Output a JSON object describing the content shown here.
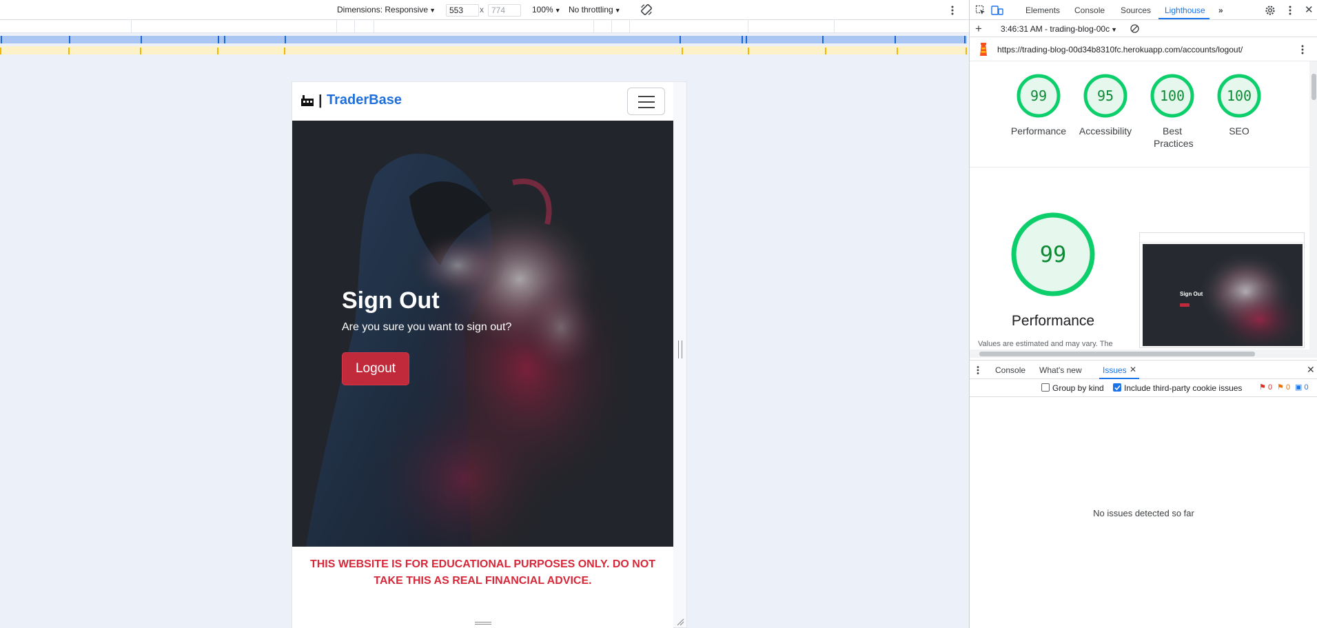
{
  "device_toolbar": {
    "dimensions_label": "Dimensions: Responsive",
    "width_value": "553",
    "times": "x",
    "height_value": "774",
    "zoom": "100%",
    "throttling": "No throttling"
  },
  "page": {
    "brand_separator": "|",
    "brand_name": "TraderBase",
    "hero_title": "Sign Out",
    "hero_subtitle": "Are you sure you want to sign out?",
    "logout_label": "Logout",
    "disclaimer": "THIS WEBSITE IS FOR EDUCATIONAL PURPOSES ONLY. DO NOT TAKE THIS AS REAL FINANCIAL ADVICE."
  },
  "devtools": {
    "tabs": [
      "Elements",
      "Console",
      "Sources",
      "Lighthouse"
    ],
    "active_tab": "Lighthouse",
    "report_selector": "3:46:31 AM - trading-blog-00c",
    "url": "https://trading-blog-00d34b8310fc.herokuapp.com/accounts/logout/",
    "scores": [
      {
        "value": "99",
        "label": "Performance"
      },
      {
        "value": "95",
        "label": "Accessibility"
      },
      {
        "value": "100",
        "label": "Best Practices"
      },
      {
        "value": "100",
        "label": "SEO"
      }
    ],
    "main_score": {
      "value": "99",
      "label": "Performance"
    },
    "estimate_note": "Values are estimated and may vary. The",
    "thumb_title": "Sign Out",
    "drawer_tabs": [
      "Console",
      "What's new",
      "Issues"
    ],
    "active_drawer_tab": "Issues",
    "group_by_kind": "Group by kind",
    "include_third_party": "Include third-party cookie issues",
    "counts": {
      "errors": "0",
      "warnings": "0",
      "info": "0"
    },
    "no_issues": "No issues detected so far"
  },
  "colors": {
    "brand": "#1e6fdc",
    "danger": "#c02a3b",
    "score_good": "#0cce6b",
    "accent": "#1a73e8"
  }
}
